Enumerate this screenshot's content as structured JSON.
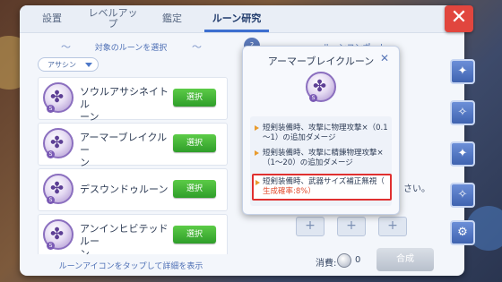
{
  "tabs": [
    {
      "label": "設置"
    },
    {
      "label": "レベルアッ\nプ"
    },
    {
      "label": "鑑定"
    },
    {
      "label": "ルーン研究"
    }
  ],
  "close_icon": "close-icon",
  "left": {
    "filter_title": "対象のルーンを選択",
    "dropdown_value": "アサシン",
    "runes": [
      {
        "name": "ソウルアサシネイトル\nーン",
        "button": "選択"
      },
      {
        "name": "アーマーブレイクルー\nン",
        "button": "選択"
      },
      {
        "name": "デスウンドゥルーン",
        "button": "選択"
      },
      {
        "name": "アンインヒビテッドルー\nン",
        "button": "選択"
      }
    ],
    "tap_hint": "ルーンアイコンをタップして詳細を表示"
  },
  "right": {
    "section_title": "ルーンコンポ...ト",
    "behind_text": "さい。",
    "cost_label": "消費:",
    "cost_value": "0",
    "create_button": "合成"
  },
  "popup": {
    "title": "アーマーブレイクルーン",
    "effects": [
      {
        "text": "短剣装備時、攻撃に物理攻撃×（0.1～1）の追加ダメージ"
      },
      {
        "text": "短剣装備時、攻撃に精錬物理攻撃×（1～20）の追加ダメージ"
      },
      {
        "text": "短剣装備時、武器サイズ補正無視（",
        "rate": "生成確率:8%）"
      }
    ]
  },
  "colors": {
    "accent": "#3d6fd0",
    "select_button": "#3fae35",
    "close_button": "#e1463e",
    "highlight_border": "#e03030",
    "rate_text": "#e24a2c"
  }
}
